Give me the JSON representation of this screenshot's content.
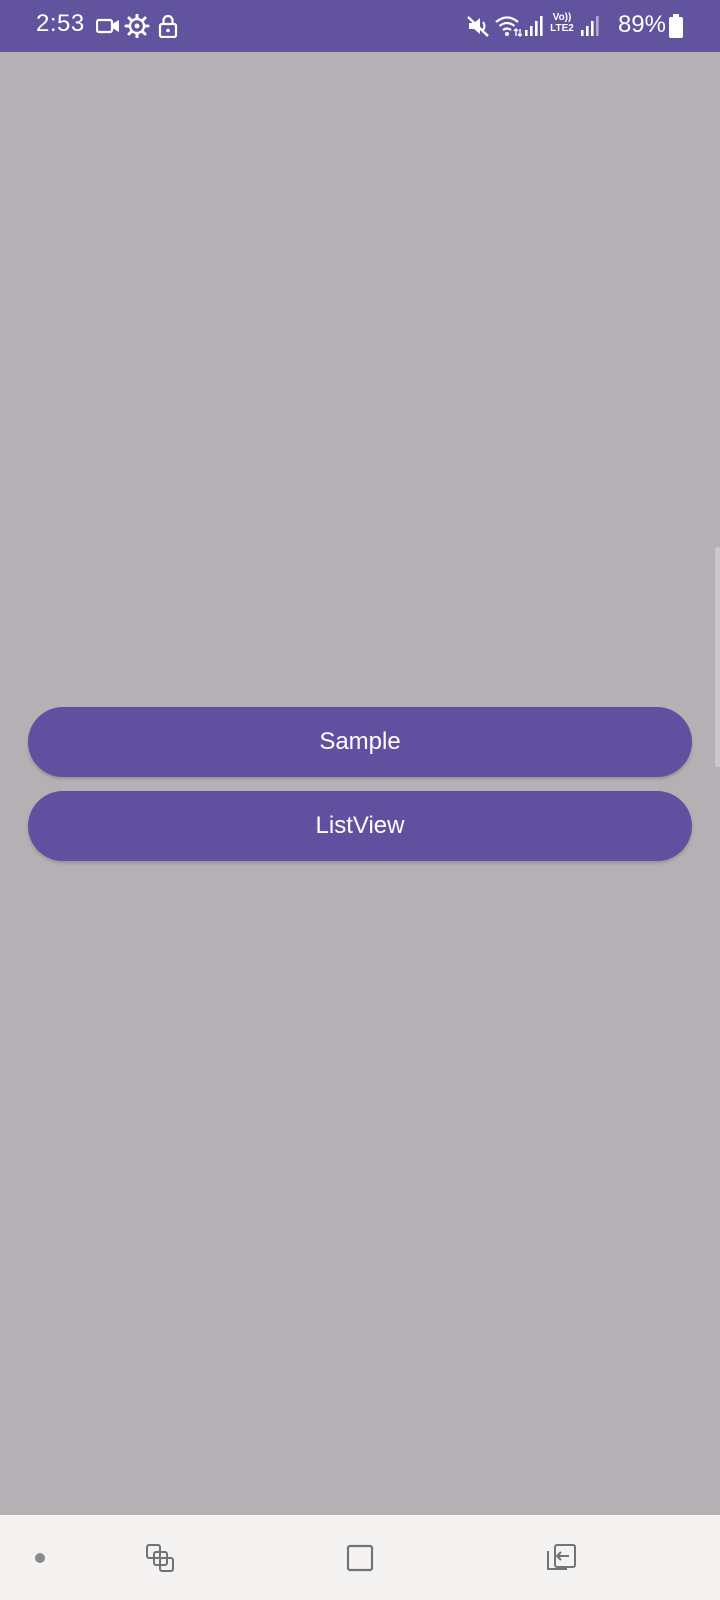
{
  "status_bar": {
    "time": "2:53",
    "battery_percent": "89%",
    "background_color": "#62539f",
    "left_icons": [
      "video-camera-icon",
      "settings-gear-icon",
      "lock-icon"
    ],
    "right_icons": [
      "mute-icon",
      "wifi-icon",
      "signal-icon",
      "volte-lte2-icon",
      "signal-icon",
      "battery-icon"
    ],
    "volte_label": "Vo)) LTE2"
  },
  "main": {
    "background_color": "#b3b1b4",
    "buttons": [
      {
        "label": "Sample"
      },
      {
        "label": "ListView"
      }
    ],
    "button_color": "#6150a0"
  },
  "nav_bar": {
    "items": [
      "dot-icon",
      "recent-apps-icon",
      "home-icon",
      "back-icon"
    ]
  }
}
